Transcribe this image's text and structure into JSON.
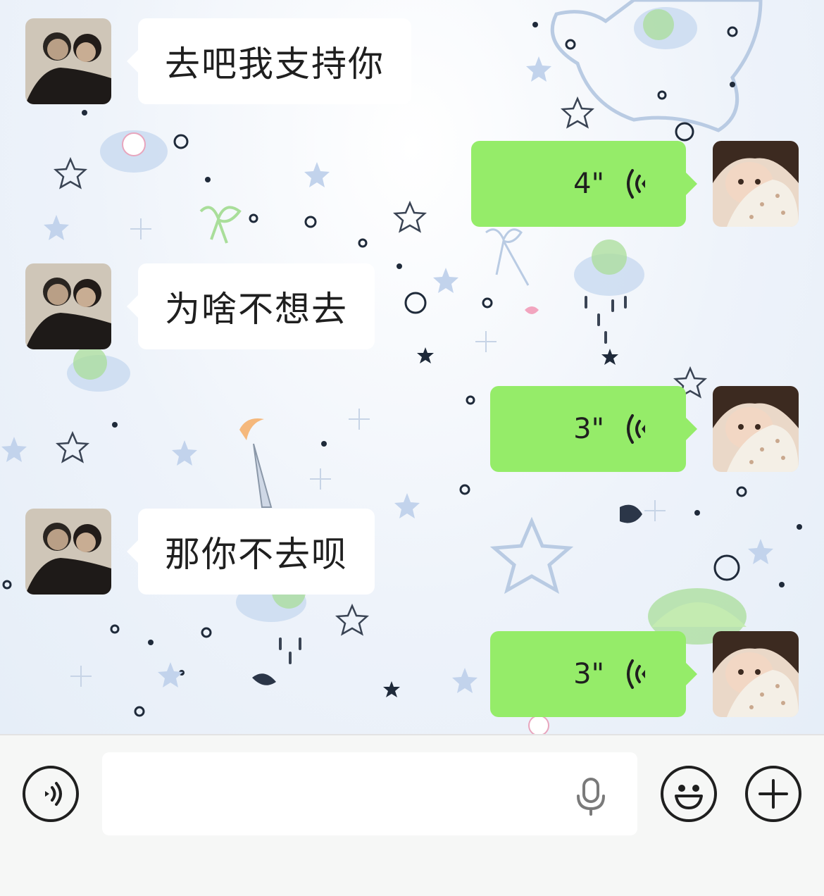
{
  "messages": [
    {
      "side": "left",
      "type": "text",
      "text": "去吧我支持你"
    },
    {
      "side": "right",
      "type": "voice",
      "duration": "4\""
    },
    {
      "side": "left",
      "type": "text",
      "text": "为啥不想去"
    },
    {
      "side": "right",
      "type": "voice",
      "duration": "3\""
    },
    {
      "side": "left",
      "type": "text",
      "text": "那你不去呗"
    },
    {
      "side": "right",
      "type": "voice",
      "duration": "3\""
    }
  ],
  "input_bar": {
    "voice_toggle_icon": "voice-mode-icon",
    "input_value": "",
    "mic_icon": "microphone-icon",
    "emoji_icon": "emoji-icon",
    "more_icon": "plus-icon"
  },
  "colors": {
    "my_bubble": "#95ec69",
    "their_bubble": "#ffffff",
    "input_bar_bg": "#f6f7f6",
    "icon_stroke": "#1f1f1f"
  }
}
